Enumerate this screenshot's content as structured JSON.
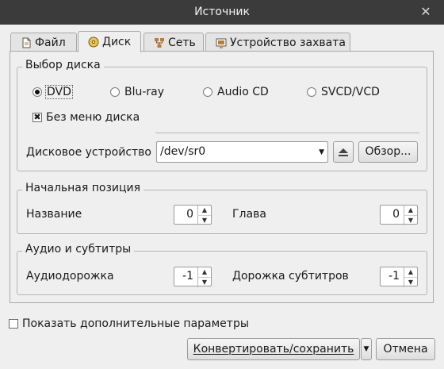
{
  "window": {
    "title": "Источник",
    "close_glyph": "✕"
  },
  "tabs": [
    {
      "label": "Файл",
      "icon": "file-icon",
      "active": false
    },
    {
      "label": "Диск",
      "icon": "disc-icon",
      "active": true
    },
    {
      "label": "Сеть",
      "icon": "network-icon",
      "active": false
    },
    {
      "label": "Устройство захвата",
      "icon": "capture-device-icon",
      "active": false
    }
  ],
  "disc_selection": {
    "legend": "Выбор диска",
    "options": [
      "DVD",
      "Blu-ray",
      "Audio CD",
      "SVCD/VCD"
    ],
    "selected": "DVD",
    "no_menu_label": "Без меню диска",
    "no_menu_checked": true,
    "device_label": "Дисковое устройство",
    "device_value": "/dev/sr0",
    "browse_label": "Обзор..."
  },
  "start_position": {
    "legend": "Начальная позиция",
    "title_label": "Название",
    "title_value": "0",
    "chapter_label": "Глава",
    "chapter_value": "0"
  },
  "audio_subs": {
    "legend": "Аудио и субтитры",
    "audio_label": "Аудиодорожка",
    "audio_value": "-1",
    "subs_label": "Дорожка субтитров",
    "subs_value": "-1"
  },
  "footer": {
    "more_options_label": "Показать дополнительные параметры",
    "more_options_checked": false,
    "convert_label": "Конвертировать/сохранить",
    "cancel_label": "Отмена"
  }
}
